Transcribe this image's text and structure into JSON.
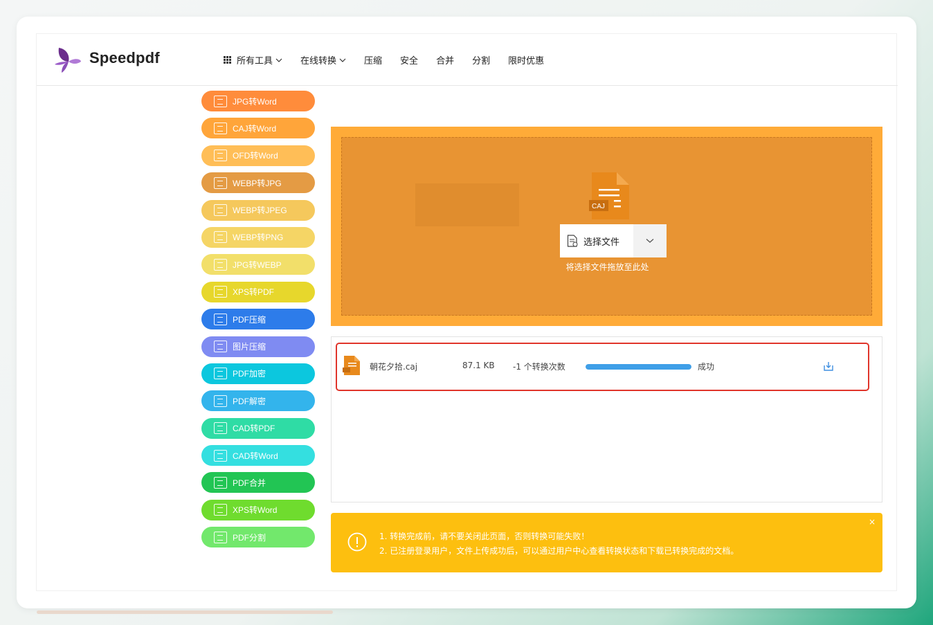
{
  "brand": {
    "name": "Speedpdf"
  },
  "nav": {
    "items": [
      {
        "label": "所有工具",
        "icon": "grid-icon",
        "dropdown": true
      },
      {
        "label": "在线转换",
        "dropdown": true
      },
      {
        "label": "压缩"
      },
      {
        "label": "安全"
      },
      {
        "label": "合并"
      },
      {
        "label": "分割"
      },
      {
        "label": "限时优惠"
      }
    ]
  },
  "sidebar": {
    "items": [
      {
        "label": "JPG转Word",
        "color": "#ff8c3b"
      },
      {
        "label": "CAJ转Word",
        "color": "#ffa53a"
      },
      {
        "label": "OFD转Word",
        "color": "#ffbe57"
      },
      {
        "label": "WEBP转JPG",
        "color": "#e49b44"
      },
      {
        "label": "WEBP转JPEG",
        "color": "#f5c85c"
      },
      {
        "label": "WEBP转PNG",
        "color": "#f5d565"
      },
      {
        "label": "JPG转WEBP",
        "color": "#f2df6a"
      },
      {
        "label": "XPS转PDF",
        "color": "#e7d72c"
      },
      {
        "label": "PDF压缩",
        "color": "#2d7cea"
      },
      {
        "label": "图片压缩",
        "color": "#7f8bf2"
      },
      {
        "label": "PDF加密",
        "color": "#0cc7de"
      },
      {
        "label": "PDF解密",
        "color": "#33b4ec"
      },
      {
        "label": "CAD转PDF",
        "color": "#2fdca5"
      },
      {
        "label": "CAD转Word",
        "color": "#34dfe0"
      },
      {
        "label": "PDF合并",
        "color": "#22c554"
      },
      {
        "label": "XPS转Word",
        "color": "#6fdc2e"
      },
      {
        "label": "PDF分割",
        "color": "#72e86c"
      }
    ]
  },
  "upload": {
    "file_badge": "CAJ",
    "select_label": "选择文件",
    "drop_hint": "将选择文件拖放至此处"
  },
  "file": {
    "name": "朝花夕拾.caj",
    "size": "87.1 KB",
    "count": "-1 个转换次数",
    "progress": 1.0,
    "status": "成功"
  },
  "notice": {
    "line1": "1. 转换完成前，请不要关闭此页面，否则转换可能失败！",
    "line2": "2. 已注册登录用户，文件上传成功后，可以通过用户中心查看转换状态和下载已转换完成的文档。",
    "close": "×"
  }
}
